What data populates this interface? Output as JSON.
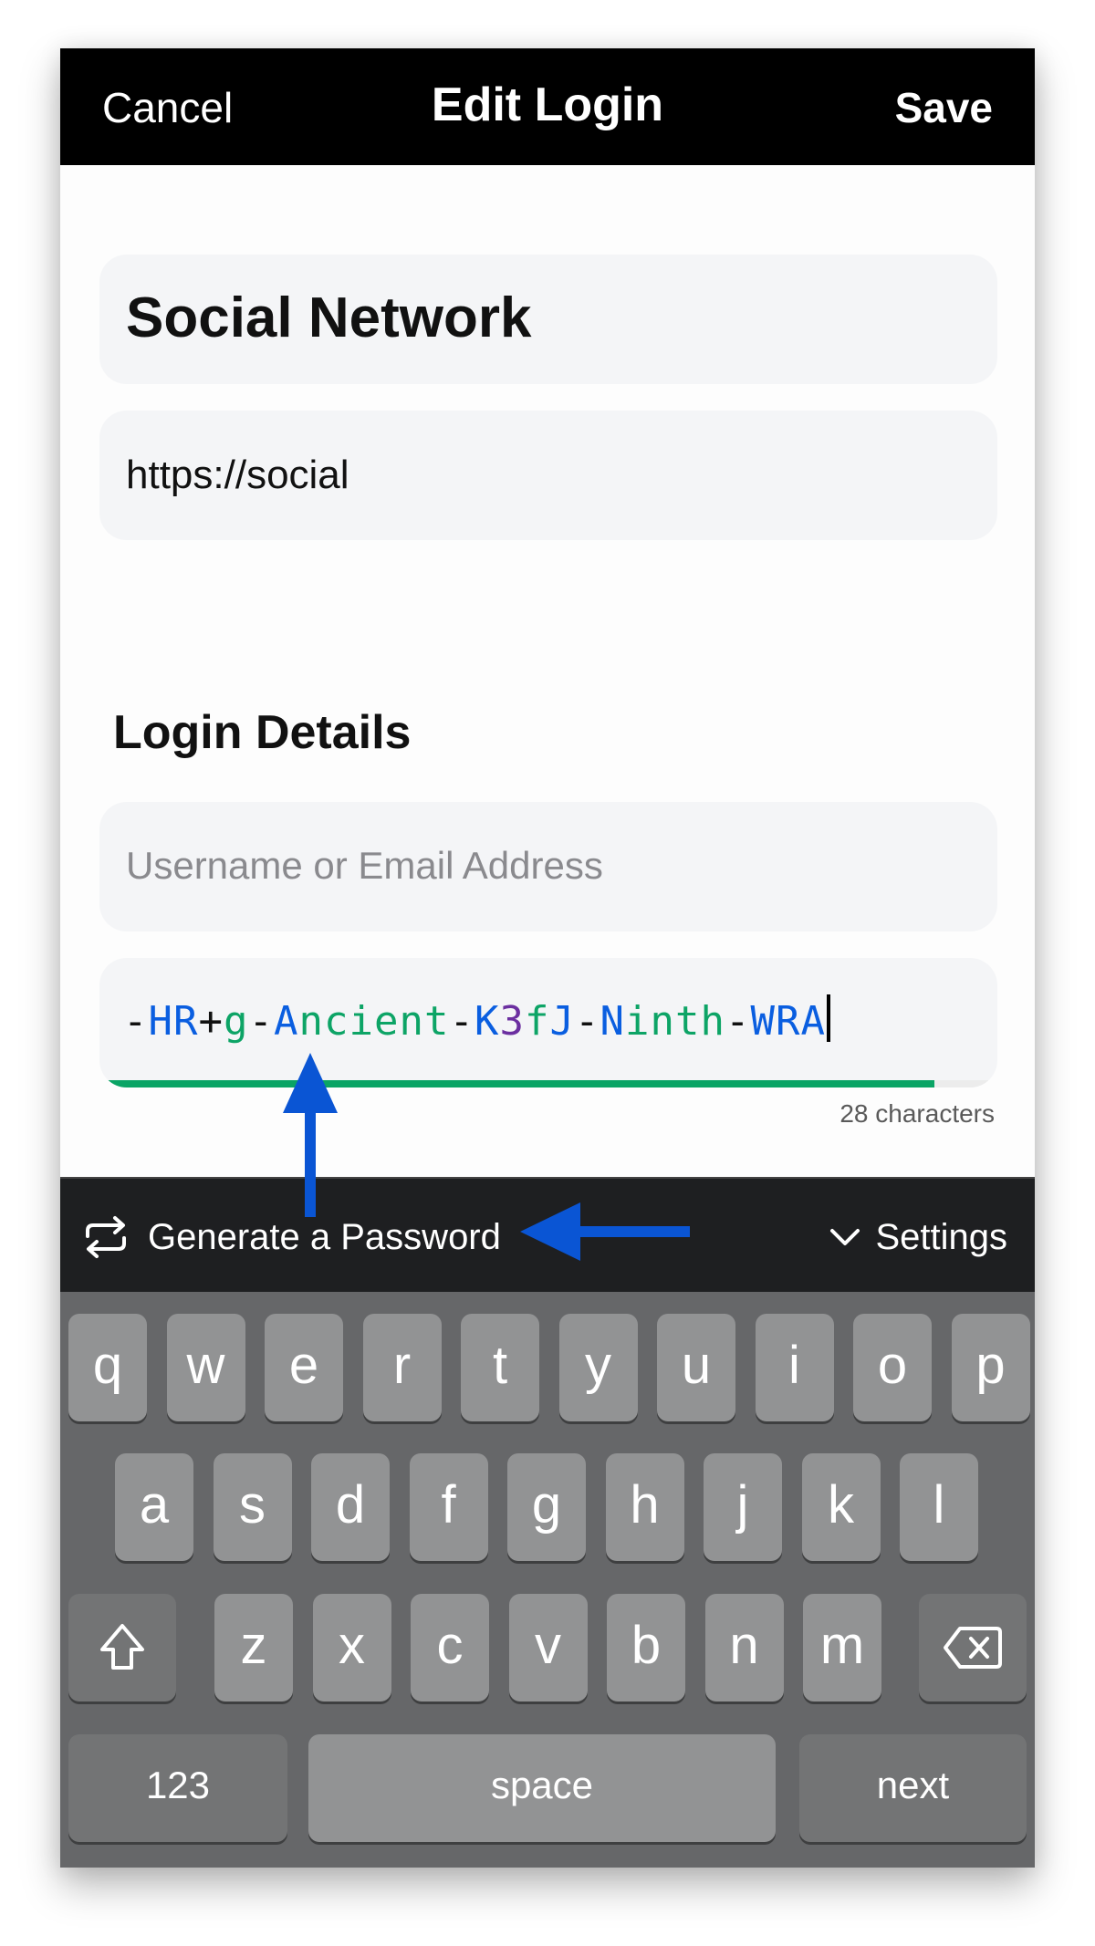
{
  "nav": {
    "cancel_label": "Cancel",
    "title": "Edit Login",
    "save_label": "Save"
  },
  "item": {
    "title": "Social Network",
    "url": "https://social"
  },
  "login_details": {
    "heading": "Login Details",
    "username_placeholder": "Username or Email Address",
    "username_value": "",
    "password_value": "-HR+g-Ancient-K3fJ-Ninth-WRA",
    "password_strength": 0.93,
    "char_count_label": "28 characters"
  },
  "toolbar": {
    "generate_icon": "repeat-arrows-icon",
    "generate_label": "Generate a Password",
    "settings_icon": "chevron-down-icon",
    "settings_label": "Settings"
  },
  "keyboard": {
    "row1": [
      "q",
      "w",
      "e",
      "r",
      "t",
      "y",
      "u",
      "i",
      "o",
      "p"
    ],
    "row2": [
      "a",
      "s",
      "d",
      "f",
      "g",
      "h",
      "j",
      "k",
      "l"
    ],
    "row3": [
      "z",
      "x",
      "c",
      "v",
      "b",
      "n",
      "m"
    ],
    "shift_icon": "shift-arrow-icon",
    "delete_icon": "backspace-icon",
    "numbers_label": "123",
    "space_label": "space",
    "next_label": "next"
  },
  "annotations": {
    "arrow_color": "#0a55d4",
    "arrows": [
      "arrow-up-to-password",
      "arrow-left-to-generate"
    ]
  },
  "colors": {
    "uppercase": "#0a5ee0",
    "lowercase": "#0da466",
    "digit": "#6b2fa0",
    "symbol": "#111111",
    "strength_bar": "#0aa465"
  }
}
